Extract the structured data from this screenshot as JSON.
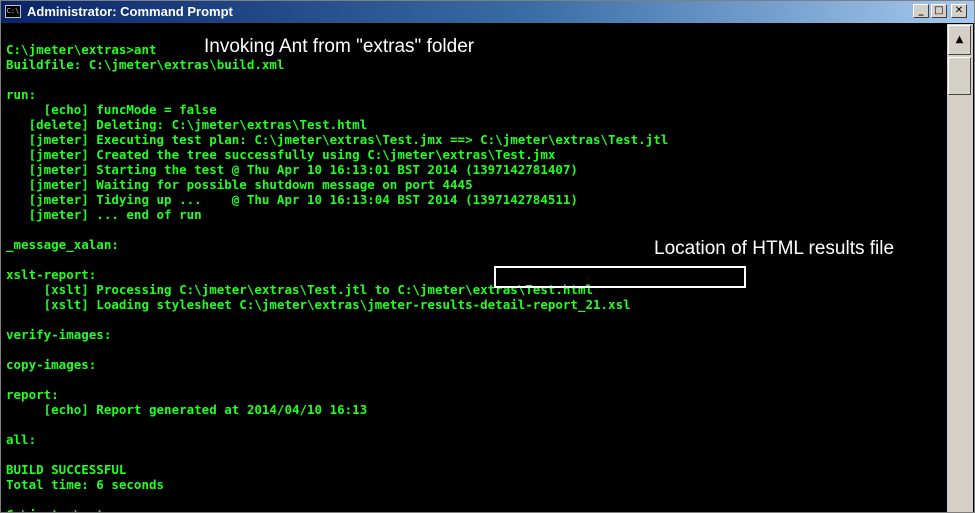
{
  "window": {
    "title": "Administrator: Command Prompt",
    "icon_label": "C:\\",
    "controls": {
      "minimize": "_",
      "maximize": "□",
      "close": "✕"
    }
  },
  "console": {
    "lines": [
      "C:\\jmeter\\extras>ant",
      "Buildfile: C:\\jmeter\\extras\\build.xml",
      "",
      "run:",
      "     [echo] funcMode = false",
      "   [delete] Deleting: C:\\jmeter\\extras\\Test.html",
      "   [jmeter] Executing test plan: C:\\jmeter\\extras\\Test.jmx ==> C:\\jmeter\\extras\\Test.jtl",
      "   [jmeter] Created the tree successfully using C:\\jmeter\\extras\\Test.jmx",
      "   [jmeter] Starting the test @ Thu Apr 10 16:13:01 BST 2014 (1397142781407)",
      "   [jmeter] Waiting for possible shutdown message on port 4445",
      "   [jmeter] Tidying up ...    @ Thu Apr 10 16:13:04 BST 2014 (1397142784511)",
      "   [jmeter] ... end of run",
      "",
      "_message_xalan:",
      "",
      "xslt-report:",
      "     [xslt] Processing C:\\jmeter\\extras\\Test.jtl to C:\\jmeter\\extras\\Test.html",
      "     [xslt] Loading stylesheet C:\\jmeter\\extras\\jmeter-results-detail-report_21.xsl",
      "",
      "verify-images:",
      "",
      "copy-images:",
      "",
      "report:",
      "     [echo] Report generated at 2014/04/10 16:13",
      "",
      "all:",
      "",
      "BUILD SUCCESSFUL",
      "Total time: 6 seconds",
      "",
      "C:\\jmeter\\extras>"
    ]
  },
  "annotations": {
    "invoking_ant": "Invoking Ant from \"extras\" folder",
    "html_location": "Location of HTML results file"
  },
  "colors": {
    "console_text": "#20ff20",
    "console_background": "#000000",
    "annotation_text": "#ffffff"
  },
  "icons": {
    "scroll_up": "triangle-up-icon"
  }
}
